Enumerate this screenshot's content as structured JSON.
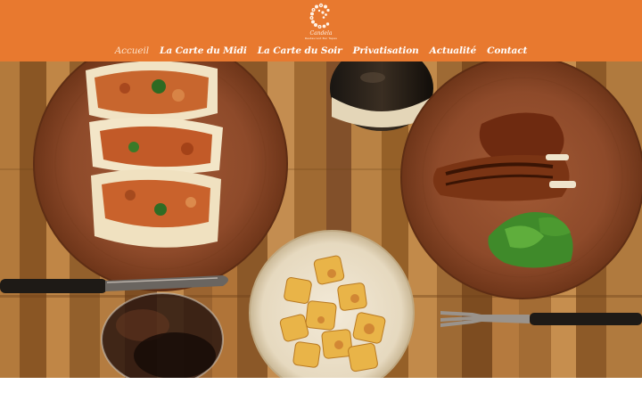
{
  "brand": {
    "name": "Candela",
    "tagline": "Restaurant Bar Tapas",
    "logo_icon": "flower-c-logo"
  },
  "nav": {
    "items": [
      {
        "label": "Accueil",
        "active": true
      },
      {
        "label": "La Carte du Midi",
        "active": false
      },
      {
        "label": "La Carte du Soir",
        "active": false
      },
      {
        "label": "Privatisation",
        "active": false
      },
      {
        "label": "Actualité",
        "active": false
      },
      {
        "label": "Contact",
        "active": false
      }
    ]
  },
  "hero": {
    "image": "overhead-food-photo",
    "content": [
      "pulled-meat-tacos-plate",
      "wine-bottle",
      "grilled-ribs-plate",
      "knife",
      "wine-glass",
      "roasted-potatoes-bowl",
      "fork"
    ]
  },
  "colors": {
    "header_bg": "#e8792f",
    "nav_text": "#ffffff",
    "nav_active": "#fde2c9",
    "page_bg": "#ffffff"
  }
}
